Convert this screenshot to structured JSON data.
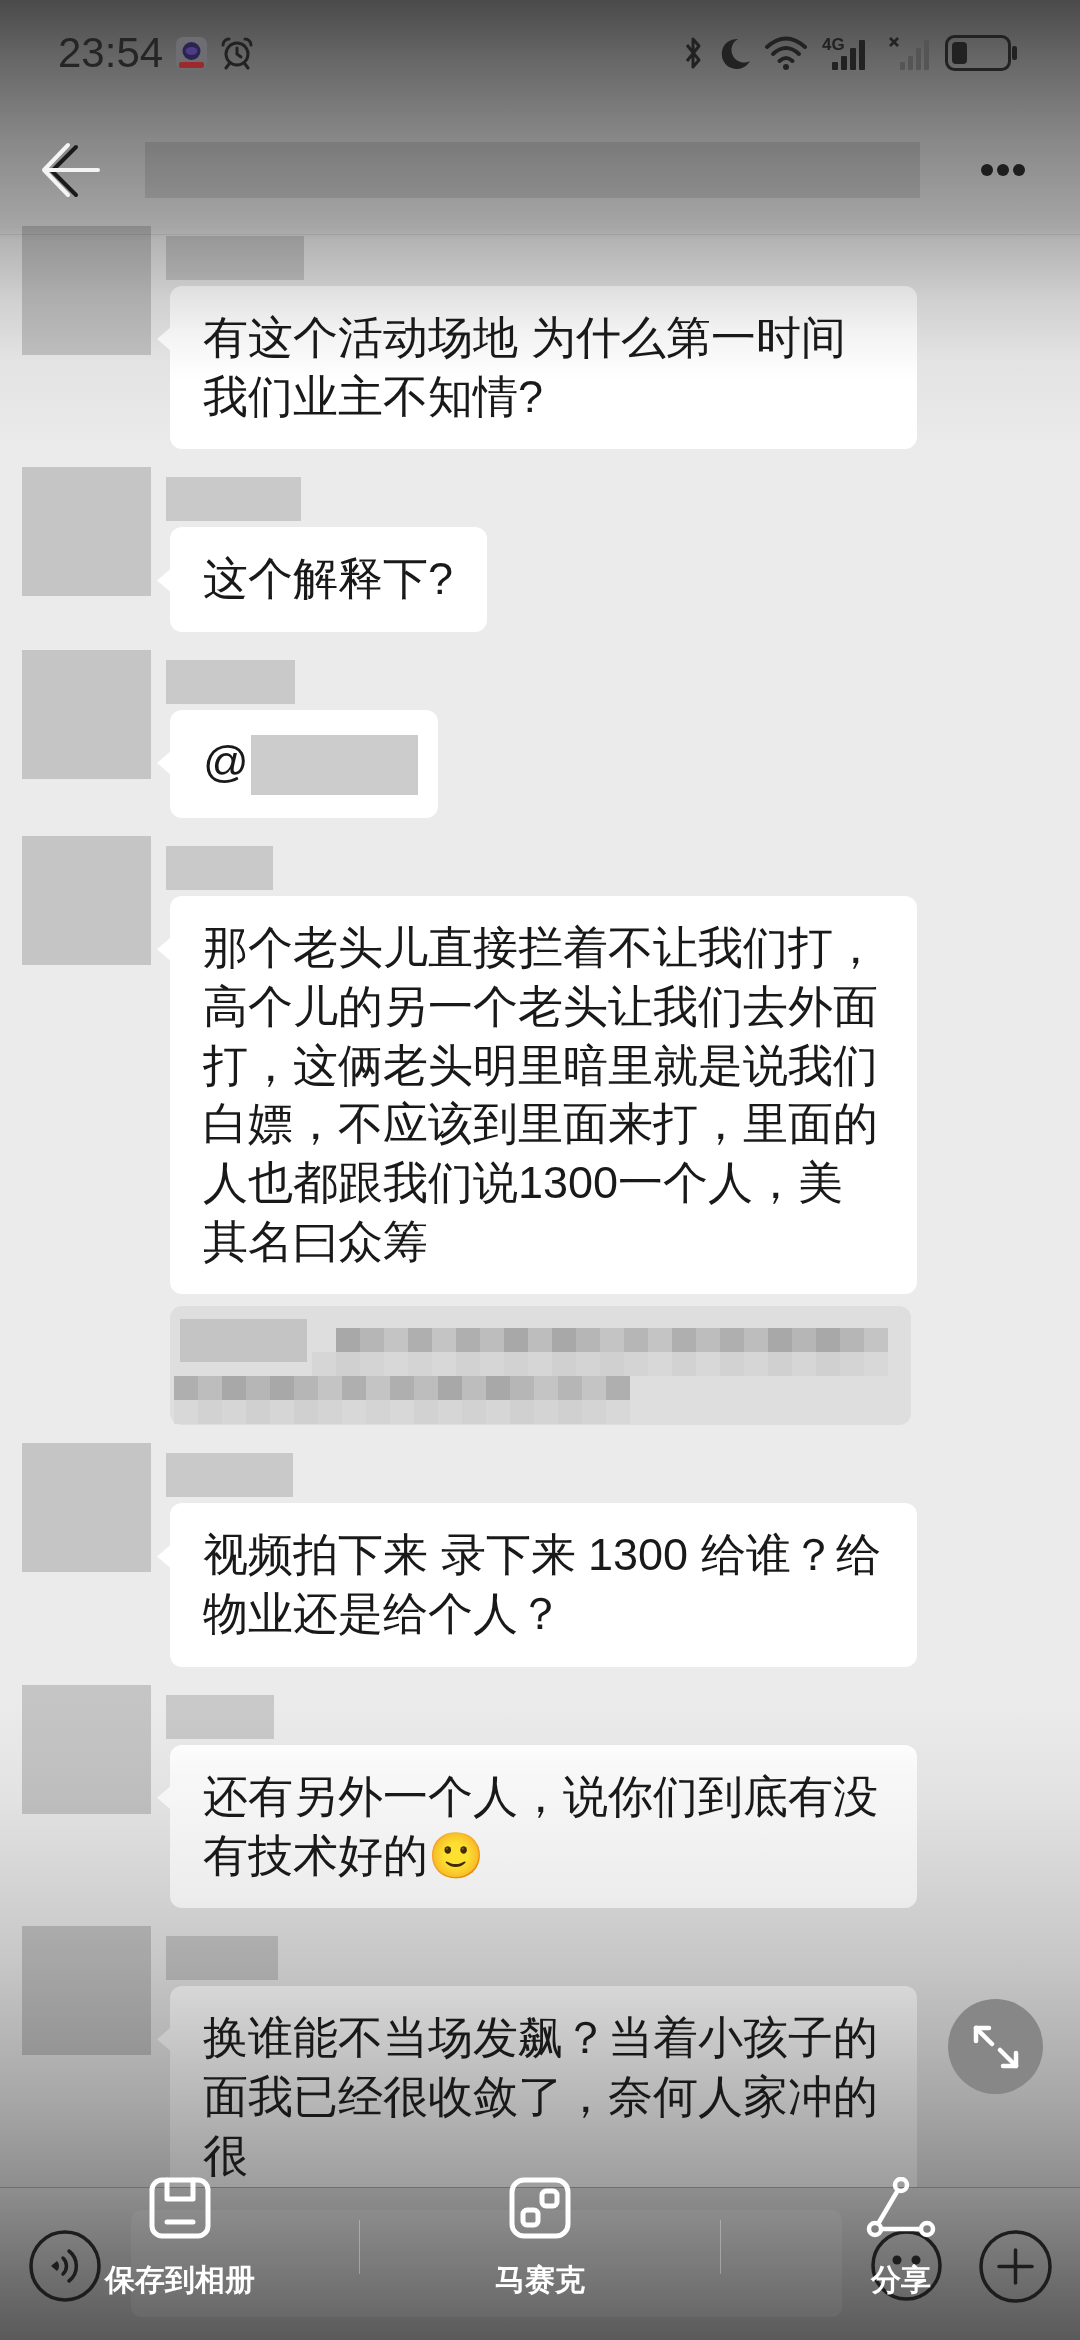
{
  "status_bar": {
    "time": "23:54",
    "network_type": "4G"
  },
  "messages": [
    {
      "kind": "text",
      "text": "有这个活动场地 为什么第一时间我们业主不知情?"
    },
    {
      "kind": "text",
      "text": "这个解释下?"
    },
    {
      "kind": "mention",
      "text": "@"
    },
    {
      "kind": "text",
      "text": "那个老头儿直接拦着不让我们打，高个儿的另一个老头让我们去外面打，这俩老头明里暗里就是说我们白嫖，不应该到里面来打，里面的人也都跟我们说1300一个人，美其名曰众筹"
    },
    {
      "kind": "quote"
    },
    {
      "kind": "text",
      "text": "视频拍下来 录下来 1300 给谁？给物业还是给个人？"
    },
    {
      "kind": "text",
      "text": "还有另外一个人，说你们到底有没有技术好的🙂"
    },
    {
      "kind": "text",
      "text": "换谁能不当场发飙？当着小孩子的面我已经很收敛了，奈何人家冲的很"
    }
  ],
  "editor_toolbar": [
    {
      "kind": "save",
      "label": "保存到相册"
    },
    {
      "kind": "mosaic",
      "label": "马赛克"
    },
    {
      "kind": "share",
      "label": "分享"
    }
  ]
}
